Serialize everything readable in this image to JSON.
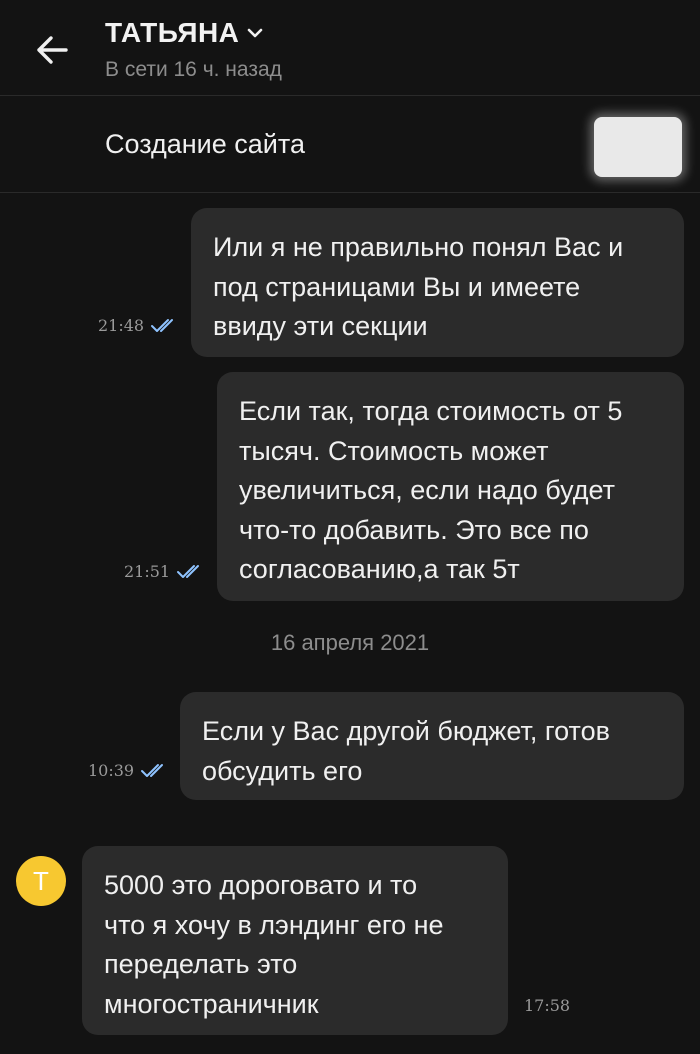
{
  "header": {
    "name": "ТАТЬЯНА",
    "status": "В сети 16 ч. назад",
    "back_icon": "arrow-left-icon",
    "dropdown_icon": "chevron-down-icon"
  },
  "subject": {
    "title": "Создание сайта"
  },
  "messages": [
    {
      "direction": "outgoing",
      "text": "Или я не правильно понял Вас и\nпод страницами Вы и имеете\nввиду эти секции",
      "time": "21:48",
      "status_icon": "double-check-icon"
    },
    {
      "direction": "outgoing",
      "text": "Если так, тогда стоимость от 5\nтысяч. Стоимость может\nувеличиться, если надо будет\nчто-то добавить. Это все по\nсогласованию,а так 5т",
      "time": "21:51",
      "status_icon": "double-check-icon"
    },
    {
      "direction": "outgoing",
      "text": "Если у Вас другой бюджет, готов\nобсудить его",
      "time": "10:39",
      "status_icon": "double-check-icon"
    },
    {
      "direction": "incoming",
      "text": "5000 это дороговато и то\nчто я хочу в лэндинг его не\nпеределать это\nмногостраничник",
      "time": "17:58"
    }
  ],
  "date_separator": "16 апреля 2021",
  "avatar": {
    "letter": "Т",
    "color": "#f7c830"
  },
  "colors": {
    "background": "#131313",
    "bubble": "#2b2b2b",
    "check": "#8fc3ff"
  }
}
